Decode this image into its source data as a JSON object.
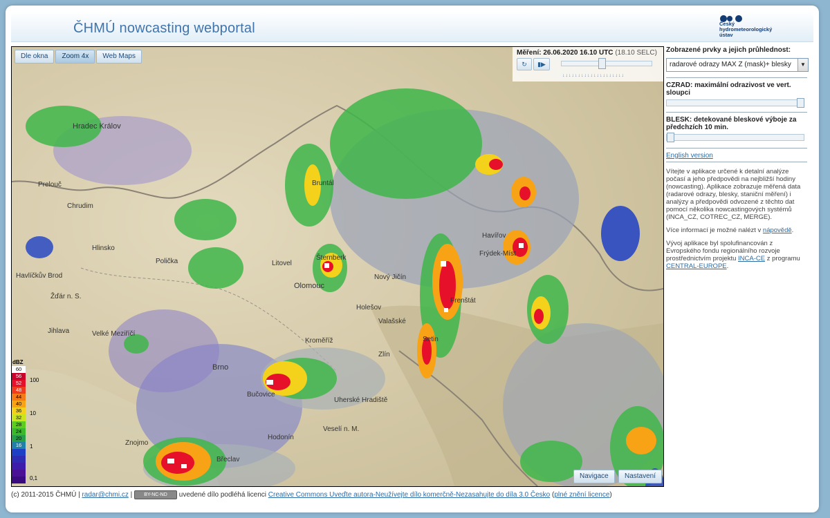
{
  "app": {
    "title": "ČHMÚ nowcasting webportal"
  },
  "logo": {
    "line1": "Český",
    "line2": "hydrometeorologický",
    "line3": "ústav"
  },
  "view_tabs": [
    {
      "label": "Dle okna"
    },
    {
      "label": "Zoom 4x"
    },
    {
      "label": "Web Maps"
    }
  ],
  "measurement": {
    "label": "Měření:",
    "datetime": "26.06.2020 16.10 UTC",
    "local": "(18.10 SELC)",
    "refresh_icon": "refresh-icon",
    "play_icon": "play-pause-icon",
    "timeline_position": 0.44
  },
  "legend": {
    "unit": "dBZ",
    "levels": [
      {
        "value": "60",
        "color": "#ffffff",
        "text_color": "#000000"
      },
      {
        "value": "56",
        "color": "#c8002a",
        "text_color": "#ffffff"
      },
      {
        "value": "52",
        "color": "#e6102a",
        "text_color": "#ffffff"
      },
      {
        "value": "48",
        "color": "#f03c1e",
        "text_color": "#ffffff"
      },
      {
        "value": "44",
        "color": "#f57a17",
        "text_color": "#000000"
      },
      {
        "value": "40",
        "color": "#f7a315",
        "text_color": "#000000"
      },
      {
        "value": "36",
        "color": "#f4d21c",
        "text_color": "#000000"
      },
      {
        "value": "32",
        "color": "#cbe51c",
        "text_color": "#000000"
      },
      {
        "value": "28",
        "color": "#5ccd1d",
        "text_color": "#000000"
      },
      {
        "value": "24",
        "color": "#3bb82c",
        "text_color": "#000000"
      },
      {
        "value": "20",
        "color": "#26a048",
        "text_color": "#000000"
      },
      {
        "value": "16",
        "color": "#2080a8",
        "text_color": "#ffffff"
      },
      {
        "value": "",
        "color": "#1e40c4",
        "text_color": "#ffffff"
      },
      {
        "value": "",
        "color": "#2e2cb2",
        "text_color": "#ffffff"
      },
      {
        "value": "",
        "color": "#3e1cab",
        "text_color": "#ffffff"
      },
      {
        "value": "",
        "color": "#4a1096",
        "text_color": "#ffffff"
      },
      {
        "value": "",
        "color": "#3a0a80",
        "text_color": "#ffffff"
      }
    ],
    "rates": [
      "100",
      "10",
      "1",
      "0,1"
    ]
  },
  "map_buttons": {
    "navigation": "Navigace",
    "settings": "Nastavení"
  },
  "cities": [
    "Hradec Králov",
    "Prelouč",
    "Chrudim",
    "Hlinsko",
    "Polička",
    "Havlíčkův Brod",
    "Žďár n. S.",
    "Jihlava",
    "Velké Meziříčí",
    "Brno",
    "Znojmo",
    "Břeclav",
    "Bruntál",
    "Šternberk",
    "Olomouc",
    "Nový Jičín",
    "Frenštát",
    "Valašské",
    "Setin",
    "Uherské Hradiště",
    "Veselí n. M.",
    "Hodonín",
    "Kroměříž",
    "Bučovice",
    "Havířov",
    "Frýdek-Míst",
    "Litovel",
    "Holešov",
    "Zlín"
  ],
  "sidebar": {
    "heading": "Zobrazené prvky a jejich průhlednost:",
    "select_value": "radarové odrazy MAX Z (mask)+ blesky",
    "czrad_title": "CZRAD: maximální odrazivost ve vert. sloupci",
    "czrad_opacity": 1.0,
    "blesk_title": "BLESK: detekované bleskové výboje za předchzích 10 min.",
    "blesk_opacity": 0.0,
    "english_link": "English version",
    "intro": "Vítejte v aplikace určené k detalní analýze počasí a jeho předpovědi na nejbližší hodiny (nowcasting). Aplikace zobrazuje měřená data (radarové odrazy, blesky, staniční měření) i analýzy a předpovědi odvozené z těchto dat pomocí několika nowcastingových systémů (INCA_CZ, COTREC_CZ, MERGE).",
    "more_info_prefix": "Více informací je možné nalézt v ",
    "more_info_link": "nápovědě",
    "more_info_suffix": ".",
    "funding_prefix": "Vývoj aplikace byl spolufinancován z Evropského fondu regionálního rozvoje prostřednictvím projektu ",
    "funding_link1": "INCA-CE",
    "funding_middle": " z programu ",
    "funding_link2": "CENTRAL-EUROPE",
    "funding_suffix": "."
  },
  "footer": {
    "copyright": "(c) 2011-2015 ČHMÚ | ",
    "email": "radar@chmi.cz",
    "separator": " | ",
    "badge": "BY-NC-ND",
    "license_prefix": " uvedené dílo podléhá licenci ",
    "license_link": "Creative Commons Uveďte autora-Neužívejte dílo komerčně-Nezasahujte do díla 3.0 Česko",
    "full_prefix": " (",
    "full_link": "plné znění licence",
    "full_suffix": ")"
  }
}
